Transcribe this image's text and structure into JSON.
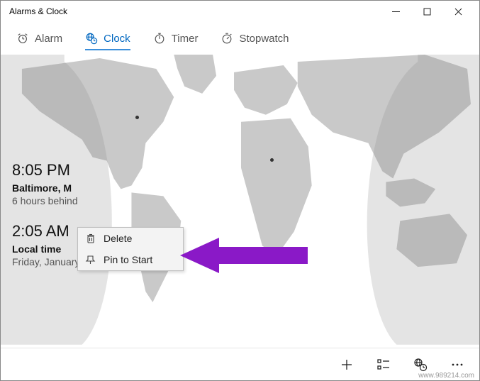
{
  "window": {
    "title": "Alarms & Clock"
  },
  "tabs": {
    "alarm": {
      "label": "Alarm"
    },
    "clock": {
      "label": "Clock"
    },
    "timer": {
      "label": "Timer"
    },
    "stopwatch": {
      "label": "Stopwatch"
    }
  },
  "clocks": [
    {
      "time": "8:05 PM",
      "place": "Baltimore, M",
      "sub": "6 hours behind"
    },
    {
      "time": "2:05 AM",
      "place": "Local time",
      "sub": "Friday, January 10, 2020"
    }
  ],
  "context_menu": {
    "delete": "Delete",
    "pin": "Pin to Start"
  },
  "watermark": "www.989214.com"
}
